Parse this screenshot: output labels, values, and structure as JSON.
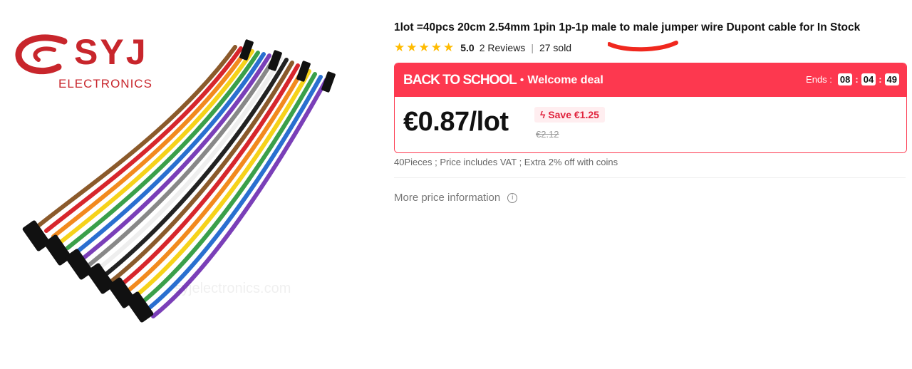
{
  "brand": {
    "logo_text": "SYJ",
    "logo_subtext": "ELECTRONICS",
    "watermark": "syjelectronics.com"
  },
  "product": {
    "title": "1lot =40pcs 20cm 2.54mm 1pin 1p-1p male to male jumper wire Dupont cable for In Stock",
    "rating": "5.0",
    "star_count": 5,
    "reviews": "2 Reviews",
    "separator": "|",
    "sold": "27 sold"
  },
  "deal": {
    "name": "BACK TO SCHOOL",
    "dot": "•",
    "subtitle": "Welcome deal",
    "ends_label": "Ends :",
    "hours": "08",
    "minutes": "04",
    "seconds": "49",
    "colon": ":"
  },
  "price": {
    "current": "€0.87/lot",
    "save_label": "Save €1.25",
    "original": "€2.12",
    "note": "40Pieces ; Price includes VAT ; Extra 2% off with coins"
  },
  "more_info": {
    "label": "More price information",
    "icon_glyph": "i"
  },
  "colors": {
    "deal_red": "#fd384f",
    "star_yellow": "#ffbb00",
    "save_red": "#e0233d",
    "logo_red": "#c8262c"
  },
  "icons": [
    "star-icon",
    "lightning-icon",
    "info-icon",
    "scribble-annotation"
  ]
}
